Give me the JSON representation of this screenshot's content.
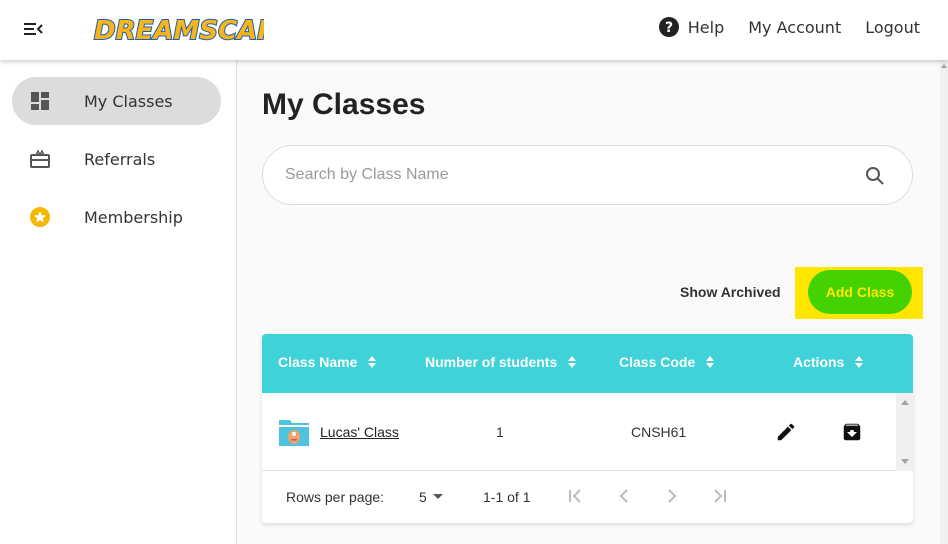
{
  "header": {
    "logo_text": "DREAMSCAPE",
    "nav": {
      "help": "Help",
      "my_account": "My Account",
      "logout": "Logout"
    }
  },
  "sidebar": {
    "items": [
      {
        "label": "My Classes",
        "icon": "dashboard-icon",
        "active": true
      },
      {
        "label": "Referrals",
        "icon": "gift-card-icon",
        "active": false
      },
      {
        "label": "Membership",
        "icon": "star-badge-icon",
        "active": false
      }
    ]
  },
  "main": {
    "title": "My Classes",
    "search": {
      "placeholder": "Search by Class Name",
      "value": ""
    },
    "show_archived": "Show Archived",
    "add_class": "Add Class",
    "table": {
      "columns": [
        "Class Name",
        "Number of students",
        "Class Code",
        "Actions"
      ],
      "rows": [
        {
          "class_name": "Lucas' Class",
          "students": "1",
          "class_code": "CNSH61"
        }
      ],
      "footer": {
        "rows_per_page_label": "Rows per page:",
        "rows_per_page_value": "5",
        "range": "1-1 of 1"
      }
    }
  },
  "colors": {
    "header_teal": "#3fd3d9",
    "add_button_green": "#44d200",
    "add_button_text": "#ffe600",
    "highlight_yellow": "#ffe600",
    "membership_star": "#f5b800"
  }
}
